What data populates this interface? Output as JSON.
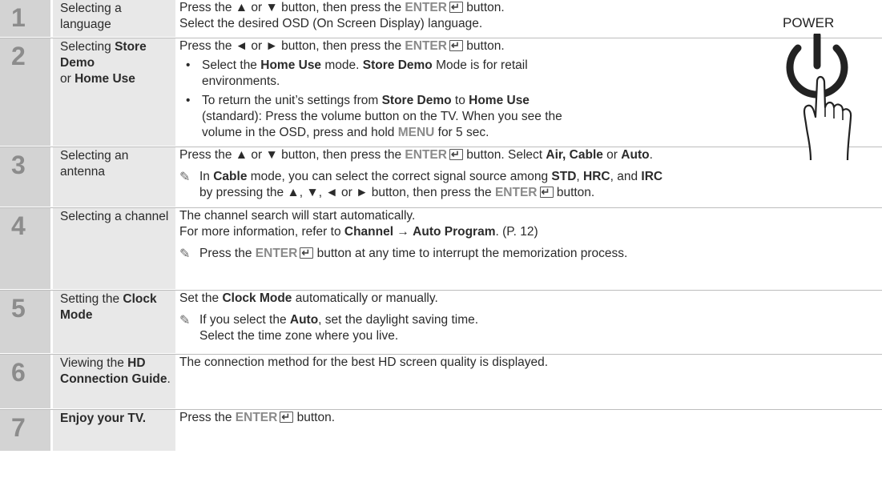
{
  "power": {
    "label": "POWER"
  },
  "steps": [
    {
      "num": "1",
      "title_parts": [
        "Selecting a language"
      ],
      "lines": [
        {
          "type": "text",
          "parts": [
            {
              "t": "Press the ▲ or ▼ button, then press the "
            },
            {
              "t": "ENTER",
              "k": 1
            },
            {
              "icon": "enter"
            },
            {
              "t": " button."
            }
          ]
        },
        {
          "type": "text",
          "parts": [
            {
              "t": "Select the desired OSD (On Screen Display) language."
            }
          ]
        }
      ]
    },
    {
      "num": "2",
      "title_parts": [
        {
          "t": "Selecting "
        },
        {
          "t": "Store Demo",
          "b": 1
        },
        {
          "br": 1
        },
        {
          "t": "or "
        },
        {
          "t": "Home Use",
          "b": 1
        }
      ],
      "lines": [
        {
          "type": "text",
          "parts": [
            {
              "t": "Press the ◄ or ► button, then press the "
            },
            {
              "t": "ENTER",
              "k": 1
            },
            {
              "icon": "enter"
            },
            {
              "t": " button."
            }
          ]
        },
        {
          "type": "bullet",
          "dot": "•",
          "rows": [
            [
              {
                "t": "Select the "
              },
              {
                "t": "Home Use",
                "b": 1
              },
              {
                "t": " mode. "
              },
              {
                "t": "Store Demo",
                "b": 1
              },
              {
                "t": " Mode is for retail"
              }
            ],
            [
              {
                "t": "environments."
              }
            ]
          ]
        },
        {
          "type": "bullet",
          "dot": "•",
          "rows": [
            [
              {
                "t": "To return the unit’s settings from "
              },
              {
                "t": "Store Demo",
                "b": 1
              },
              {
                "t": " to "
              },
              {
                "t": "Home Use",
                "b": 1
              }
            ],
            [
              {
                "t": "(standard): Press the volume button on the TV. When you see the"
              }
            ],
            [
              {
                "t": "volume in the OSD, press and hold "
              },
              {
                "t": "MENU",
                "k": 1
              },
              {
                "t": " for 5 sec."
              }
            ]
          ]
        }
      ]
    },
    {
      "num": "3",
      "title_parts": [
        "Selecting an antenna"
      ],
      "lines": [
        {
          "type": "text",
          "parts": [
            {
              "t": "Press the ▲ or ▼ button, then press the "
            },
            {
              "t": "ENTER",
              "k": 1
            },
            {
              "icon": "enter"
            },
            {
              "t": " button. Select "
            },
            {
              "t": "Air, Cable",
              "b": 1
            },
            {
              "t": " or "
            },
            {
              "t": "Auto",
              "b": 1
            },
            {
              "t": "."
            }
          ]
        },
        {
          "type": "note",
          "icon": "✎",
          "rows": [
            [
              {
                "t": "In "
              },
              {
                "t": "Cable",
                "b": 1
              },
              {
                "t": " mode, you can select the correct signal source among "
              },
              {
                "t": "STD",
                "b": 1
              },
              {
                "t": ", "
              },
              {
                "t": "HRC",
                "b": 1
              },
              {
                "t": ", and "
              },
              {
                "t": "IRC",
                "b": 1
              }
            ],
            [
              {
                "t": "by pressing the ▲, ▼, ◄ or ► button, then press the "
              },
              {
                "t": "ENTER",
                "k": 1
              },
              {
                "icon": "enter"
              },
              {
                "t": " button."
              }
            ]
          ]
        }
      ]
    },
    {
      "num": "4",
      "title_parts": [
        "Selecting a channel"
      ],
      "lines": [
        {
          "type": "text",
          "parts": [
            {
              "t": "The channel search will start automatically."
            }
          ]
        },
        {
          "type": "text",
          "parts": [
            {
              "t": "For more information, refer to "
            },
            {
              "t": "Channel",
              "b": 1
            },
            {
              "t": " → "
            },
            {
              "t": "Auto Program",
              "b": 1
            },
            {
              "t": ". (P. 12)"
            }
          ]
        },
        {
          "type": "note",
          "icon": "✎",
          "rows": [
            [
              {
                "t": "Press the "
              },
              {
                "t": "ENTER",
                "k": 1
              },
              {
                "icon": "enter"
              },
              {
                "t": " button at any time to interrupt the memorization process."
              }
            ]
          ]
        }
      ]
    },
    {
      "num": "5",
      "title_parts": [
        {
          "t": "Setting the "
        },
        {
          "t": "Clock",
          "b": 1
        },
        {
          "br": 1
        },
        {
          "t": "Mode",
          "b": 1
        }
      ],
      "lines": [
        {
          "type": "text",
          "parts": [
            {
              "t": "Set the "
            },
            {
              "t": "Clock Mode",
              "b": 1
            },
            {
              "t": " automatically or manually."
            }
          ]
        },
        {
          "type": "note",
          "icon": "✎",
          "rows": [
            [
              {
                "t": "If you select the "
              },
              {
                "t": "Auto",
                "b": 1
              },
              {
                "t": ", set the daylight saving time."
              }
            ],
            [
              {
                "t": "Select the time zone where you live."
              }
            ]
          ]
        }
      ]
    },
    {
      "num": "6",
      "title_parts": [
        {
          "t": "Viewing the "
        },
        {
          "t": "HD",
          "b": 1
        },
        {
          "br": 1
        },
        {
          "t": "Connection Guide",
          "b": 1
        },
        {
          "t": "."
        }
      ],
      "lines": [
        {
          "type": "text",
          "parts": [
            {
              "t": "The connection method for the best HD screen quality is displayed."
            }
          ]
        }
      ]
    },
    {
      "num": "7",
      "title_parts": [
        {
          "t": "Enjoy your TV.",
          "b": 1
        }
      ],
      "lines": [
        {
          "type": "text",
          "parts": [
            {
              "t": "Press the "
            },
            {
              "t": "ENTER",
              "k": 1
            },
            {
              "icon": "enter"
            },
            {
              "t": " button."
            }
          ]
        }
      ]
    }
  ]
}
